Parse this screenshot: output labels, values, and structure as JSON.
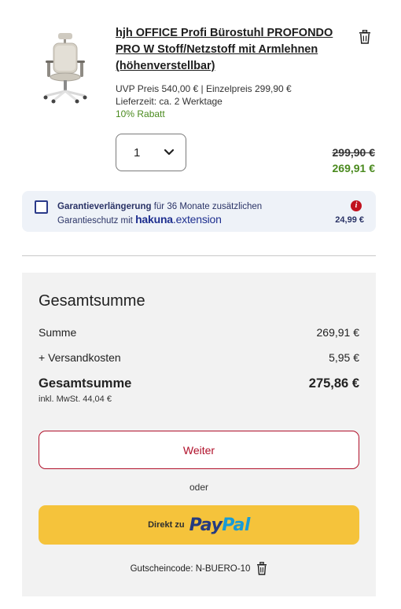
{
  "product": {
    "title": "hjh OFFICE Profi Bürostuhl PROFONDO PRO W Stoff/Netzstoff mit Armlehnen (höhenverstellbar)",
    "uvp_line": "UVP Preis  540,00 € | Einzelpreis  299,90 €",
    "delivery_line": "Lieferzeit:  ca. 2 Werktage",
    "discount_line": "10% Rabatt",
    "quantity": "1",
    "old_price": "299,90 €",
    "new_price": "269,91 €",
    "image_icon": "office-chair",
    "delete_icon": "trash-icon"
  },
  "warranty": {
    "text_bold": "Garantieverlängerung",
    "text_rest": " für 36 Monate zusätzlichen",
    "text_line2": "Garantieschutz mit ",
    "brand_part1": "hakuna",
    "brand_part2": ".extension",
    "info_glyph": "i",
    "price": "24,99 €"
  },
  "summary": {
    "title": "Gesamtsumme",
    "rows": [
      {
        "label": "Summe",
        "value": "269,91 €"
      },
      {
        "label": "+ Versandkosten",
        "value": "5,95 €"
      }
    ],
    "total_label": "Gesamtsumme",
    "total_value": "275,86 €",
    "vat_note": "inkl. MwSt. 44,04 €",
    "continue_label": "Weiter",
    "or_label": "oder",
    "paypal_prefix": "Direkt zu",
    "paypal_pay": "Pay",
    "paypal_pal": "Pal",
    "coupon_text": "Gutscheincode: N-BUERO-10"
  },
  "colors": {
    "accent_red": "#b0102a",
    "discount_green": "#4a8a1e",
    "paypal_yellow": "#f5c33b",
    "warranty_bg": "#eef2f8",
    "summary_bg": "#f2f2f2"
  }
}
